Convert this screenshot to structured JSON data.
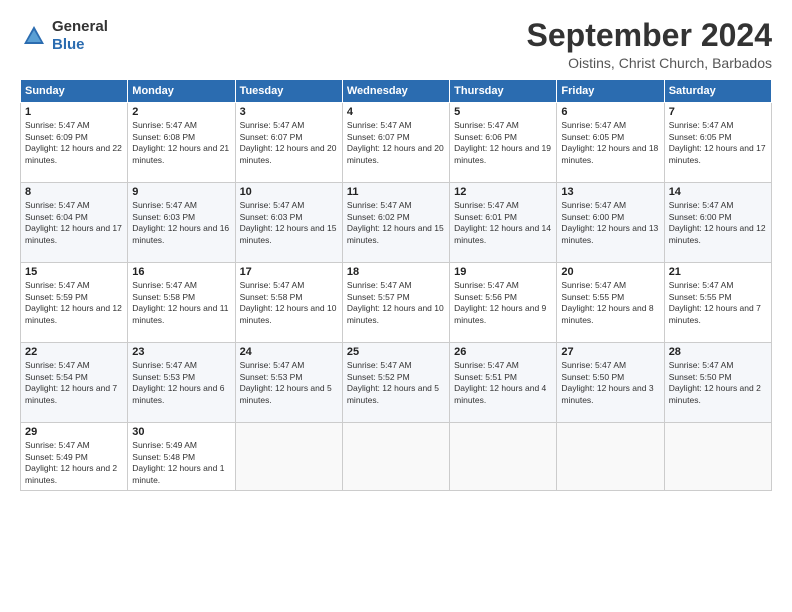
{
  "logo": {
    "general": "General",
    "blue": "Blue"
  },
  "header": {
    "month": "September 2024",
    "location": "Oistins, Christ Church, Barbados"
  },
  "weekdays": [
    "Sunday",
    "Monday",
    "Tuesday",
    "Wednesday",
    "Thursday",
    "Friday",
    "Saturday"
  ],
  "weeks": [
    [
      {
        "day": "1",
        "sunrise": "Sunrise: 5:47 AM",
        "sunset": "Sunset: 6:09 PM",
        "daylight": "Daylight: 12 hours and 22 minutes."
      },
      {
        "day": "2",
        "sunrise": "Sunrise: 5:47 AM",
        "sunset": "Sunset: 6:08 PM",
        "daylight": "Daylight: 12 hours and 21 minutes."
      },
      {
        "day": "3",
        "sunrise": "Sunrise: 5:47 AM",
        "sunset": "Sunset: 6:07 PM",
        "daylight": "Daylight: 12 hours and 20 minutes."
      },
      {
        "day": "4",
        "sunrise": "Sunrise: 5:47 AM",
        "sunset": "Sunset: 6:07 PM",
        "daylight": "Daylight: 12 hours and 20 minutes."
      },
      {
        "day": "5",
        "sunrise": "Sunrise: 5:47 AM",
        "sunset": "Sunset: 6:06 PM",
        "daylight": "Daylight: 12 hours and 19 minutes."
      },
      {
        "day": "6",
        "sunrise": "Sunrise: 5:47 AM",
        "sunset": "Sunset: 6:05 PM",
        "daylight": "Daylight: 12 hours and 18 minutes."
      },
      {
        "day": "7",
        "sunrise": "Sunrise: 5:47 AM",
        "sunset": "Sunset: 6:05 PM",
        "daylight": "Daylight: 12 hours and 17 minutes."
      }
    ],
    [
      {
        "day": "8",
        "sunrise": "Sunrise: 5:47 AM",
        "sunset": "Sunset: 6:04 PM",
        "daylight": "Daylight: 12 hours and 17 minutes."
      },
      {
        "day": "9",
        "sunrise": "Sunrise: 5:47 AM",
        "sunset": "Sunset: 6:03 PM",
        "daylight": "Daylight: 12 hours and 16 minutes."
      },
      {
        "day": "10",
        "sunrise": "Sunrise: 5:47 AM",
        "sunset": "Sunset: 6:03 PM",
        "daylight": "Daylight: 12 hours and 15 minutes."
      },
      {
        "day": "11",
        "sunrise": "Sunrise: 5:47 AM",
        "sunset": "Sunset: 6:02 PM",
        "daylight": "Daylight: 12 hours and 15 minutes."
      },
      {
        "day": "12",
        "sunrise": "Sunrise: 5:47 AM",
        "sunset": "Sunset: 6:01 PM",
        "daylight": "Daylight: 12 hours and 14 minutes."
      },
      {
        "day": "13",
        "sunrise": "Sunrise: 5:47 AM",
        "sunset": "Sunset: 6:00 PM",
        "daylight": "Daylight: 12 hours and 13 minutes."
      },
      {
        "day": "14",
        "sunrise": "Sunrise: 5:47 AM",
        "sunset": "Sunset: 6:00 PM",
        "daylight": "Daylight: 12 hours and 12 minutes."
      }
    ],
    [
      {
        "day": "15",
        "sunrise": "Sunrise: 5:47 AM",
        "sunset": "Sunset: 5:59 PM",
        "daylight": "Daylight: 12 hours and 12 minutes."
      },
      {
        "day": "16",
        "sunrise": "Sunrise: 5:47 AM",
        "sunset": "Sunset: 5:58 PM",
        "daylight": "Daylight: 12 hours and 11 minutes."
      },
      {
        "day": "17",
        "sunrise": "Sunrise: 5:47 AM",
        "sunset": "Sunset: 5:58 PM",
        "daylight": "Daylight: 12 hours and 10 minutes."
      },
      {
        "day": "18",
        "sunrise": "Sunrise: 5:47 AM",
        "sunset": "Sunset: 5:57 PM",
        "daylight": "Daylight: 12 hours and 10 minutes."
      },
      {
        "day": "19",
        "sunrise": "Sunrise: 5:47 AM",
        "sunset": "Sunset: 5:56 PM",
        "daylight": "Daylight: 12 hours and 9 minutes."
      },
      {
        "day": "20",
        "sunrise": "Sunrise: 5:47 AM",
        "sunset": "Sunset: 5:55 PM",
        "daylight": "Daylight: 12 hours and 8 minutes."
      },
      {
        "day": "21",
        "sunrise": "Sunrise: 5:47 AM",
        "sunset": "Sunset: 5:55 PM",
        "daylight": "Daylight: 12 hours and 7 minutes."
      }
    ],
    [
      {
        "day": "22",
        "sunrise": "Sunrise: 5:47 AM",
        "sunset": "Sunset: 5:54 PM",
        "daylight": "Daylight: 12 hours and 7 minutes."
      },
      {
        "day": "23",
        "sunrise": "Sunrise: 5:47 AM",
        "sunset": "Sunset: 5:53 PM",
        "daylight": "Daylight: 12 hours and 6 minutes."
      },
      {
        "day": "24",
        "sunrise": "Sunrise: 5:47 AM",
        "sunset": "Sunset: 5:53 PM",
        "daylight": "Daylight: 12 hours and 5 minutes."
      },
      {
        "day": "25",
        "sunrise": "Sunrise: 5:47 AM",
        "sunset": "Sunset: 5:52 PM",
        "daylight": "Daylight: 12 hours and 5 minutes."
      },
      {
        "day": "26",
        "sunrise": "Sunrise: 5:47 AM",
        "sunset": "Sunset: 5:51 PM",
        "daylight": "Daylight: 12 hours and 4 minutes."
      },
      {
        "day": "27",
        "sunrise": "Sunrise: 5:47 AM",
        "sunset": "Sunset: 5:50 PM",
        "daylight": "Daylight: 12 hours and 3 minutes."
      },
      {
        "day": "28",
        "sunrise": "Sunrise: 5:47 AM",
        "sunset": "Sunset: 5:50 PM",
        "daylight": "Daylight: 12 hours and 2 minutes."
      }
    ],
    [
      {
        "day": "29",
        "sunrise": "Sunrise: 5:47 AM",
        "sunset": "Sunset: 5:49 PM",
        "daylight": "Daylight: 12 hours and 2 minutes."
      },
      {
        "day": "30",
        "sunrise": "Sunrise: 5:49 AM",
        "sunset": "Sunset: 5:48 PM",
        "daylight": "Daylight: 12 hours and 1 minute."
      },
      null,
      null,
      null,
      null,
      null
    ]
  ]
}
